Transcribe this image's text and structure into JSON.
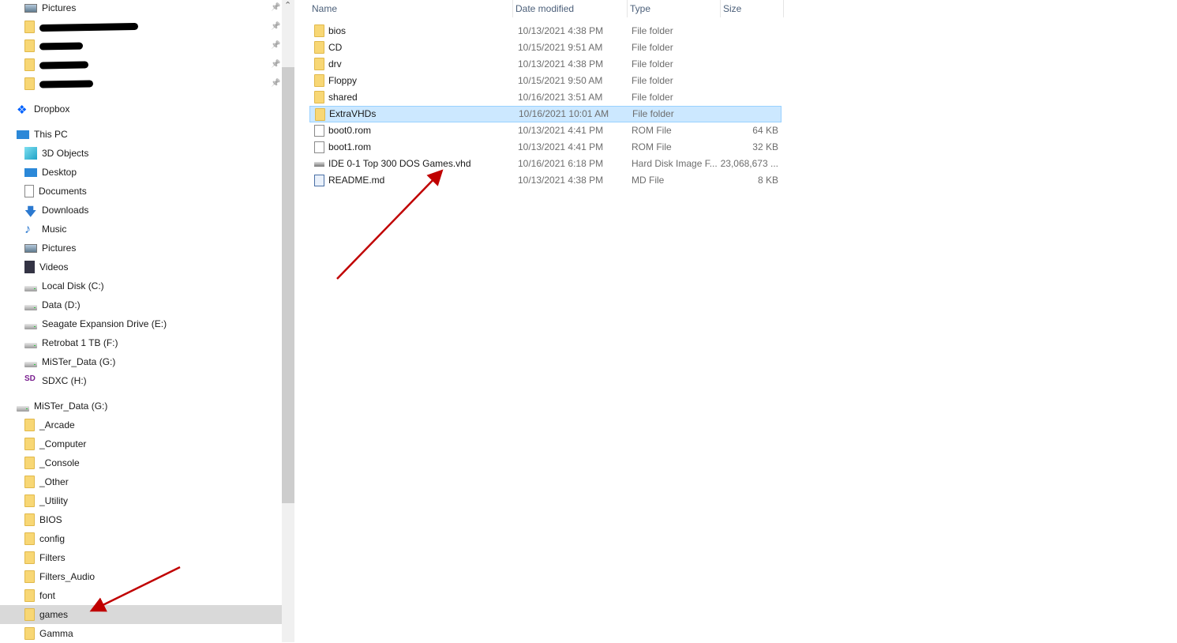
{
  "sidebar": {
    "items": [
      {
        "label": "Pictures",
        "icon": "pictures-icon",
        "pinned": true
      },
      {
        "label": "",
        "icon": "folder-icon",
        "pinned": true,
        "redacted": 125
      },
      {
        "label": "",
        "icon": "folder-icon",
        "pinned": true,
        "redacted": 55
      },
      {
        "label": "",
        "icon": "folder-icon",
        "pinned": true,
        "redacted": 62
      },
      {
        "label": "",
        "icon": "folder-icon",
        "pinned": true,
        "redacted": 68
      },
      {
        "label": "Dropbox",
        "icon": "dropbox-icon",
        "level": 0,
        "gap": true
      },
      {
        "label": "This PC",
        "icon": "this-pc-icon",
        "level": 0,
        "gap": true
      },
      {
        "label": "3D Objects",
        "icon": "3d-objects-icon"
      },
      {
        "label": "Desktop",
        "icon": "desktop-icon"
      },
      {
        "label": "Documents",
        "icon": "documents-icon"
      },
      {
        "label": "Downloads",
        "icon": "downloads-icon"
      },
      {
        "label": "Music",
        "icon": "music-icon"
      },
      {
        "label": "Pictures",
        "icon": "pictures-icon"
      },
      {
        "label": "Videos",
        "icon": "videos-icon"
      },
      {
        "label": "Local Disk (C:)",
        "icon": "drive-icon"
      },
      {
        "label": "Data (D:)",
        "icon": "drive-icon"
      },
      {
        "label": "Seagate Expansion Drive (E:)",
        "icon": "drive-icon"
      },
      {
        "label": "Retrobat 1 TB (F:)",
        "icon": "drive-icon"
      },
      {
        "label": "MiSTer_Data (G:)",
        "icon": "drive-icon"
      },
      {
        "label": "SDXC (H:)",
        "icon": "sd-card-icon"
      },
      {
        "label": "MiSTer_Data (G:)",
        "icon": "drive-icon",
        "level": 0,
        "gap": true
      },
      {
        "label": "_Arcade",
        "icon": "folder-icon"
      },
      {
        "label": "_Computer",
        "icon": "folder-icon"
      },
      {
        "label": "_Console",
        "icon": "folder-icon"
      },
      {
        "label": "_Other",
        "icon": "folder-icon"
      },
      {
        "label": "_Utility",
        "icon": "folder-icon"
      },
      {
        "label": "BIOS",
        "icon": "folder-icon"
      },
      {
        "label": "config",
        "icon": "folder-icon"
      },
      {
        "label": "Filters",
        "icon": "folder-icon"
      },
      {
        "label": "Filters_Audio",
        "icon": "folder-icon"
      },
      {
        "label": "font",
        "icon": "folder-icon"
      },
      {
        "label": "games",
        "icon": "folder-icon",
        "selected": true
      },
      {
        "label": "Gamma",
        "icon": "folder-icon"
      }
    ]
  },
  "file_list": {
    "columns": [
      "Name",
      "Date modified",
      "Type",
      "Size"
    ],
    "rows": [
      {
        "name": "bios",
        "date": "10/13/2021 4:38 PM",
        "type": "File folder",
        "size": "",
        "icon": "folder"
      },
      {
        "name": "CD",
        "date": "10/15/2021 9:51 AM",
        "type": "File folder",
        "size": "",
        "icon": "folder"
      },
      {
        "name": "drv",
        "date": "10/13/2021 4:38 PM",
        "type": "File folder",
        "size": "",
        "icon": "folder"
      },
      {
        "name": "Floppy",
        "date": "10/15/2021 9:50 AM",
        "type": "File folder",
        "size": "",
        "icon": "folder"
      },
      {
        "name": "shared",
        "date": "10/16/2021 3:51 AM",
        "type": "File folder",
        "size": "",
        "icon": "folder"
      },
      {
        "name": "ExtraVHDs",
        "date": "10/16/2021 10:01 AM",
        "type": "File folder",
        "size": "",
        "icon": "folder",
        "selected": true
      },
      {
        "name": "boot0.rom",
        "date": "10/13/2021 4:41 PM",
        "type": "ROM File",
        "size": "64 KB",
        "icon": "file"
      },
      {
        "name": "boot1.rom",
        "date": "10/13/2021 4:41 PM",
        "type": "ROM File",
        "size": "32 KB",
        "icon": "file"
      },
      {
        "name": "IDE 0-1 Top 300 DOS Games.vhd",
        "date": "10/16/2021 6:18 PM",
        "type": "Hard Disk Image F...",
        "size": "23,068,673 ...",
        "icon": "vhd"
      },
      {
        "name": "README.md",
        "date": "10/13/2021 4:38 PM",
        "type": "MD File",
        "size": "8 KB",
        "icon": "md"
      }
    ]
  },
  "annotations": {
    "arrow_color": "#c00000"
  },
  "colors": {
    "selection": "#cce8ff",
    "nav_selection": "#d9d9d9"
  }
}
